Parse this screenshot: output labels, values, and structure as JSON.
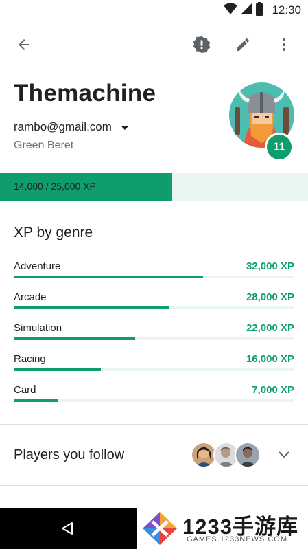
{
  "status_bar": {
    "time": "12:30"
  },
  "toolbar": {
    "icons": [
      "back-arrow-icon",
      "report-icon",
      "edit-pencil-icon",
      "more-vert-icon"
    ]
  },
  "profile": {
    "name": "Themachine",
    "email": "rambo@gmail.com",
    "rank": "Green Beret",
    "level": "11"
  },
  "xp": {
    "label": "14,000 / 25,000 XP",
    "progress": 0.56
  },
  "genres": {
    "title": "XP by genre",
    "items": [
      {
        "name": "Adventure",
        "xp": "32,000 XP",
        "fraction": 0.675
      },
      {
        "name": "Arcade",
        "xp": "28,000 XP",
        "fraction": 0.555
      },
      {
        "name": "Simulation",
        "xp": "22,000 XP",
        "fraction": 0.433
      },
      {
        "name": "Racing",
        "xp": "16,000 XP",
        "fraction": 0.31
      },
      {
        "name": "Card",
        "xp": "7,000 XP",
        "fraction": 0.158
      }
    ]
  },
  "following": {
    "title": "Players you follow",
    "avatar_count": 3
  },
  "watermark": {
    "title": "1233手游库",
    "url": "GAMES.1233NEWS.COM"
  },
  "colors": {
    "accent": "#0f9d6b",
    "track": "#e8f5f0",
    "avatar_bg": "#4cbdb1"
  }
}
